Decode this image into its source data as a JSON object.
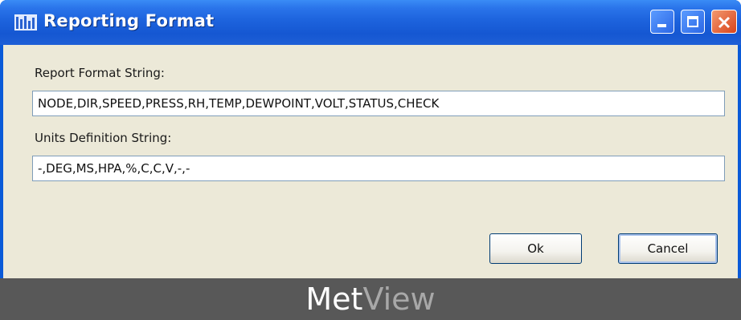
{
  "window": {
    "title": "Reporting Format",
    "app_icon": "app-window-icon",
    "controls": {
      "minimize": "minimize-icon",
      "maximize": "maximize-icon",
      "close": "close-icon"
    },
    "colors": {
      "titlebar": "#1d63dd",
      "client": "#ece9d8",
      "close": "#d9441b"
    }
  },
  "form": {
    "report_format": {
      "label": "Report Format String:",
      "value": "NODE,DIR,SPEED,PRESS,RH,TEMP,DEWPOINT,VOLT,STATUS,CHECK"
    },
    "units_definition": {
      "label": "Units Definition String:",
      "value": "-,DEG,MS,HPA,%,C,C,V,-,-"
    }
  },
  "buttons": {
    "ok": "Ok",
    "cancel": "Cancel"
  },
  "footer": {
    "brand_part1": "Met",
    "brand_part2": "View",
    "background": "#585858"
  }
}
